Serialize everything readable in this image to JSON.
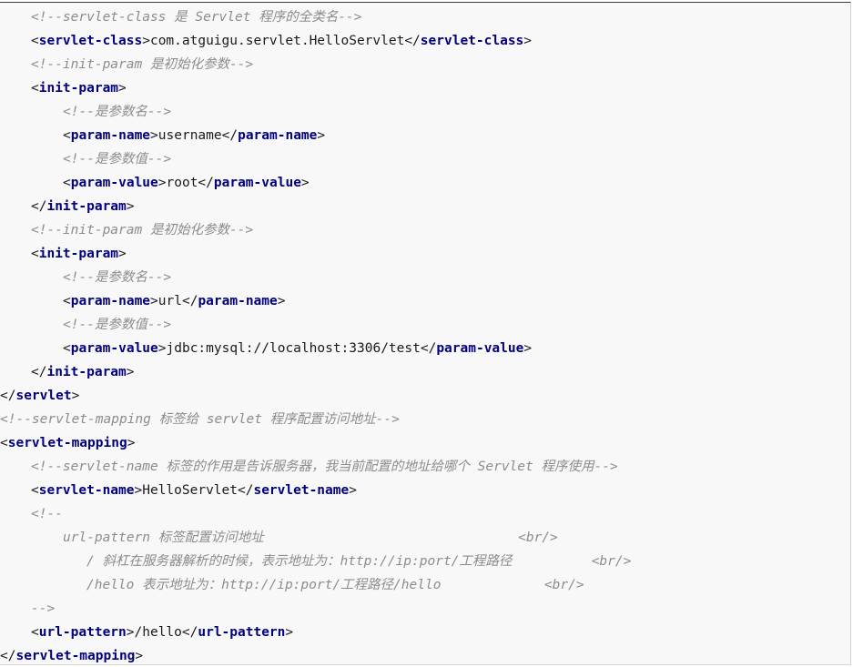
{
  "colors": {
    "background": "#f8f8f8",
    "tag": "#000080",
    "comment": "#8c8c8c",
    "text": "#1a1a1a"
  },
  "lines": [
    {
      "indent": 1,
      "parts": [
        {
          "k": "comment",
          "t": "<!--servlet-class 是 Servlet 程序的全类名-->"
        }
      ]
    },
    {
      "indent": 1,
      "parts": [
        {
          "k": "punct",
          "t": "<"
        },
        {
          "k": "tag",
          "t": "servlet-class"
        },
        {
          "k": "punct",
          "t": ">"
        },
        {
          "k": "text",
          "t": "com.atguigu.servlet.HelloServlet"
        },
        {
          "k": "punct",
          "t": "</"
        },
        {
          "k": "tag",
          "t": "servlet-class"
        },
        {
          "k": "punct",
          "t": ">"
        }
      ]
    },
    {
      "indent": 1,
      "parts": [
        {
          "k": "comment",
          "t": "<!--init-param 是初始化参数-->"
        }
      ]
    },
    {
      "indent": 1,
      "parts": [
        {
          "k": "punct",
          "t": "<"
        },
        {
          "k": "tag",
          "t": "init-param"
        },
        {
          "k": "punct",
          "t": ">"
        }
      ]
    },
    {
      "indent": 2,
      "parts": [
        {
          "k": "comment",
          "t": "<!--是参数名-->"
        }
      ]
    },
    {
      "indent": 2,
      "parts": [
        {
          "k": "punct",
          "t": "<"
        },
        {
          "k": "tag",
          "t": "param-name"
        },
        {
          "k": "punct",
          "t": ">"
        },
        {
          "k": "text",
          "t": "username"
        },
        {
          "k": "punct",
          "t": "</"
        },
        {
          "k": "tag",
          "t": "param-name"
        },
        {
          "k": "punct",
          "t": ">"
        }
      ]
    },
    {
      "indent": 2,
      "parts": [
        {
          "k": "comment",
          "t": "<!--是参数值-->"
        }
      ]
    },
    {
      "indent": 2,
      "parts": [
        {
          "k": "punct",
          "t": "<"
        },
        {
          "k": "tag",
          "t": "param-value"
        },
        {
          "k": "punct",
          "t": ">"
        },
        {
          "k": "text",
          "t": "root"
        },
        {
          "k": "punct",
          "t": "</"
        },
        {
          "k": "tag",
          "t": "param-value"
        },
        {
          "k": "punct",
          "t": ">"
        }
      ]
    },
    {
      "indent": 1,
      "parts": [
        {
          "k": "punct",
          "t": "</"
        },
        {
          "k": "tag",
          "t": "init-param"
        },
        {
          "k": "punct",
          "t": ">"
        }
      ]
    },
    {
      "indent": 1,
      "parts": [
        {
          "k": "comment",
          "t": "<!--init-param 是初始化参数-->"
        }
      ]
    },
    {
      "indent": 1,
      "parts": [
        {
          "k": "punct",
          "t": "<"
        },
        {
          "k": "tag",
          "t": "init-param"
        },
        {
          "k": "punct",
          "t": ">"
        }
      ]
    },
    {
      "indent": 2,
      "parts": [
        {
          "k": "comment",
          "t": "<!--是参数名-->"
        }
      ]
    },
    {
      "indent": 2,
      "parts": [
        {
          "k": "punct",
          "t": "<"
        },
        {
          "k": "tag",
          "t": "param-name"
        },
        {
          "k": "punct",
          "t": ">"
        },
        {
          "k": "text",
          "t": "url"
        },
        {
          "k": "punct",
          "t": "</"
        },
        {
          "k": "tag",
          "t": "param-name"
        },
        {
          "k": "punct",
          "t": ">"
        }
      ]
    },
    {
      "indent": 2,
      "parts": [
        {
          "k": "comment",
          "t": "<!--是参数值-->"
        }
      ]
    },
    {
      "indent": 2,
      "parts": [
        {
          "k": "punct",
          "t": "<"
        },
        {
          "k": "tag",
          "t": "param-value"
        },
        {
          "k": "punct",
          "t": ">"
        },
        {
          "k": "text",
          "t": "jdbc:mysql://localhost:3306/test"
        },
        {
          "k": "punct",
          "t": "</"
        },
        {
          "k": "tag",
          "t": "param-value"
        },
        {
          "k": "punct",
          "t": ">"
        }
      ]
    },
    {
      "indent": 1,
      "parts": [
        {
          "k": "punct",
          "t": "</"
        },
        {
          "k": "tag",
          "t": "init-param"
        },
        {
          "k": "punct",
          "t": ">"
        }
      ]
    },
    {
      "indent": 0,
      "parts": [
        {
          "k": "punct",
          "t": "</"
        },
        {
          "k": "tag",
          "t": "servlet"
        },
        {
          "k": "punct",
          "t": ">"
        }
      ]
    },
    {
      "indent": 0,
      "parts": [
        {
          "k": "comment",
          "t": "<!--servlet-mapping 标签给 servlet 程序配置访问地址-->"
        }
      ]
    },
    {
      "indent": 0,
      "parts": [
        {
          "k": "punct",
          "t": "<"
        },
        {
          "k": "tag",
          "t": "servlet-mapping"
        },
        {
          "k": "punct",
          "t": ">"
        }
      ]
    },
    {
      "indent": 1,
      "parts": [
        {
          "k": "comment",
          "t": "<!--servlet-name 标签的作用是告诉服务器，我当前配置的地址给哪个 Servlet 程序使用-->"
        }
      ]
    },
    {
      "indent": 1,
      "parts": [
        {
          "k": "punct",
          "t": "<"
        },
        {
          "k": "tag",
          "t": "servlet-name"
        },
        {
          "k": "punct",
          "t": ">"
        },
        {
          "k": "text",
          "t": "HelloServlet"
        },
        {
          "k": "punct",
          "t": "</"
        },
        {
          "k": "tag",
          "t": "servlet-name"
        },
        {
          "k": "punct",
          "t": ">"
        }
      ]
    },
    {
      "indent": 1,
      "parts": [
        {
          "k": "comment",
          "t": "<!--"
        }
      ]
    },
    {
      "indent": 2,
      "parts": [
        {
          "k": "comment",
          "t": "url-pattern 标签配置访问地址                                <br/>"
        }
      ]
    },
    {
      "indent": 3,
      "parts": [
        {
          "k": "comment",
          "t": "/ 斜杠在服务器解析的时候，表示地址为：http://ip:port/工程路径          <br/>"
        }
      ]
    },
    {
      "indent": 3,
      "parts": [
        {
          "k": "comment",
          "t": "/hello 表示地址为：http://ip:port/工程路径/hello             <br/>"
        }
      ]
    },
    {
      "indent": 1,
      "parts": [
        {
          "k": "comment",
          "t": "-->"
        }
      ]
    },
    {
      "indent": 1,
      "parts": [
        {
          "k": "punct",
          "t": "<"
        },
        {
          "k": "tag",
          "t": "url-pattern"
        },
        {
          "k": "punct",
          "t": ">"
        },
        {
          "k": "text",
          "t": "/hello"
        },
        {
          "k": "punct",
          "t": "</"
        },
        {
          "k": "tag",
          "t": "url-pattern"
        },
        {
          "k": "punct",
          "t": ">"
        }
      ]
    },
    {
      "indent": 0,
      "parts": [
        {
          "k": "punct",
          "t": "</"
        },
        {
          "k": "tag",
          "t": "servlet-mapping"
        },
        {
          "k": "punct",
          "t": ">"
        }
      ]
    }
  ]
}
